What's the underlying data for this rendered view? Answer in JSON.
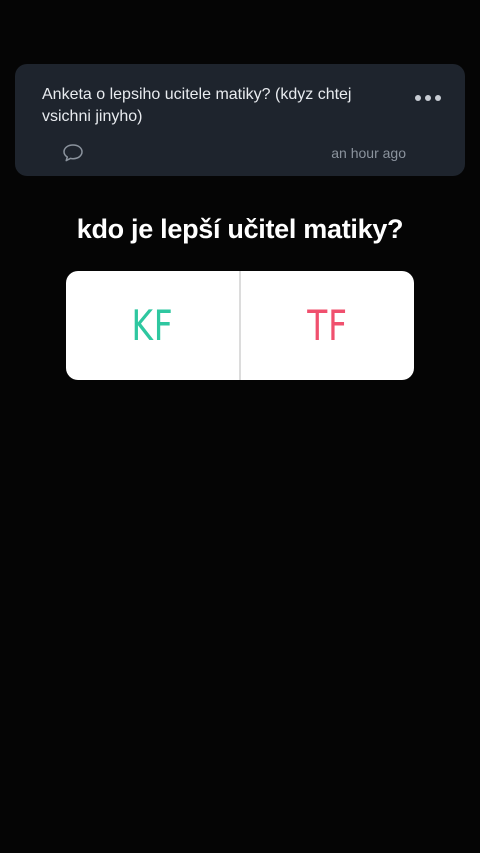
{
  "post": {
    "text": "Anketa o lepsiho ucitele matiky? (kdyz chtej vsichni jinyho)",
    "time": "an hour ago",
    "icons": {
      "more": "more-dots-icon",
      "comment": "comment-icon"
    }
  },
  "poll": {
    "question": "kdo je lepší učitel matiky?",
    "options": [
      {
        "label": "KF",
        "color": "#2ec7a0"
      },
      {
        "label": "TF",
        "color": "#f0506e"
      }
    ]
  },
  "colors": {
    "background": "#050505",
    "card": "#1e242d",
    "card_text": "#e8ebef",
    "muted_text": "#8b939d"
  }
}
